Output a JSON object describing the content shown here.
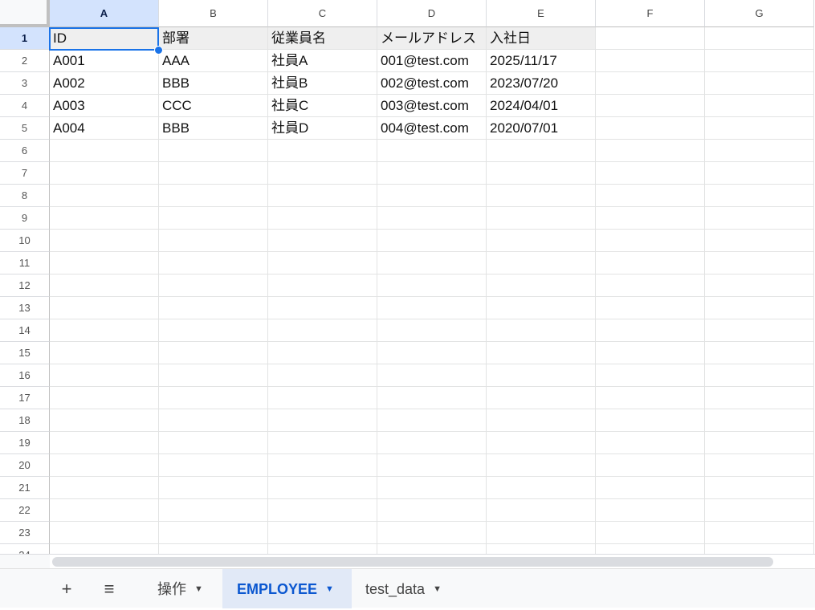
{
  "columns": [
    "A",
    "B",
    "C",
    "D",
    "E",
    "F",
    "G"
  ],
  "selected_cell": "A1",
  "row_count": 24,
  "rows": [
    [
      "ID",
      "部署",
      "従業員名",
      "メールアドレス",
      "入社日"
    ],
    [
      "A001",
      "AAA",
      "社員A",
      "001@test.com",
      "2025/11/17"
    ],
    [
      "A002",
      "BBB",
      "社員B",
      "002@test.com",
      "2023/07/20"
    ],
    [
      "A003",
      "CCC",
      "社員C",
      "003@test.com",
      "2024/04/01"
    ],
    [
      "A004",
      "BBB",
      "社員D",
      "004@test.com",
      "2020/07/01"
    ]
  ],
  "toolbar": {
    "add_sheet": "+",
    "all_sheets": "≡"
  },
  "tabs": [
    {
      "label": "操作",
      "active": false
    },
    {
      "label": "EMPLOYEE",
      "active": true
    },
    {
      "label": "test_data",
      "active": false
    }
  ],
  "caret": "▼",
  "colors": {
    "accent": "#1a73e8",
    "selected_header": "#d3e3fd",
    "active_tab": "#e1e9f7"
  }
}
